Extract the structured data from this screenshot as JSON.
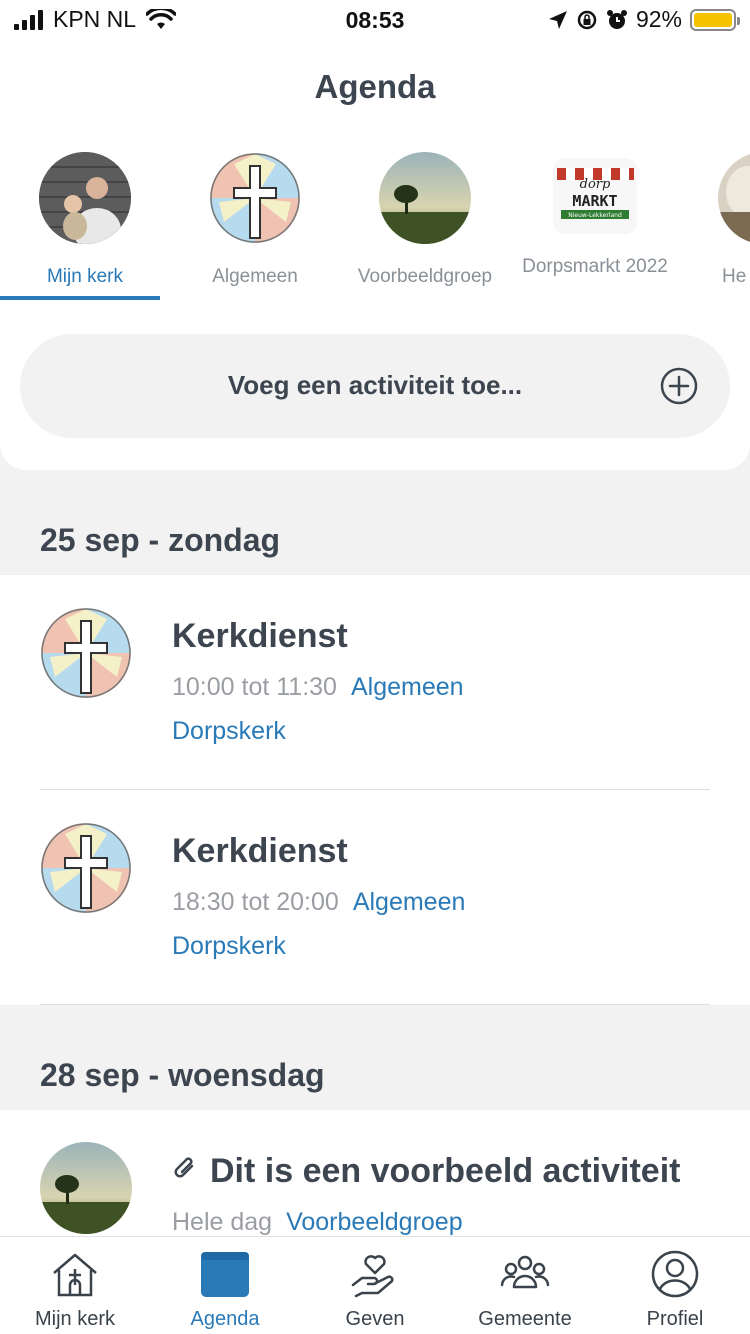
{
  "status_bar": {
    "carrier": "KPN NL",
    "time": "08:53",
    "battery": "92%"
  },
  "page_title": "Agenda",
  "groups": [
    {
      "label": "Mijn kerk",
      "active": true
    },
    {
      "label": "Algemeen"
    },
    {
      "label": "Voorbeeldgroep"
    },
    {
      "label": "Dorpsmarkt 2022"
    },
    {
      "label": "He"
    }
  ],
  "add_activity": {
    "label": "Voeg een activiteit toe..."
  },
  "days": [
    {
      "header": "25 sep - zondag",
      "events": [
        {
          "title": "Kerkdienst",
          "time": "10:00 tot 11:30",
          "group": "Algemeen",
          "location": "Dorpskerk"
        },
        {
          "title": "Kerkdienst",
          "time": "18:30 tot 20:00",
          "group": "Algemeen",
          "location": "Dorpskerk"
        }
      ]
    },
    {
      "header": "28 sep - woensdag",
      "events": [
        {
          "title": "Dit is een voorbeeld activiteit",
          "time": "Hele dag",
          "group": "Voorbeeldgroep"
        }
      ]
    }
  ],
  "bottom_nav": [
    {
      "label": "Mijn kerk",
      "icon": "church-icon"
    },
    {
      "label": "Agenda",
      "icon": "calendar-icon",
      "active": true
    },
    {
      "label": "Geven",
      "icon": "heart-hand-icon"
    },
    {
      "label": "Gemeente",
      "icon": "people-icon"
    },
    {
      "label": "Profiel",
      "icon": "profile-icon"
    }
  ],
  "colors": {
    "accent": "#2a7ab8",
    "text": "#3d4650",
    "muted": "#9a9ea3",
    "background": "#f2f2f2"
  }
}
